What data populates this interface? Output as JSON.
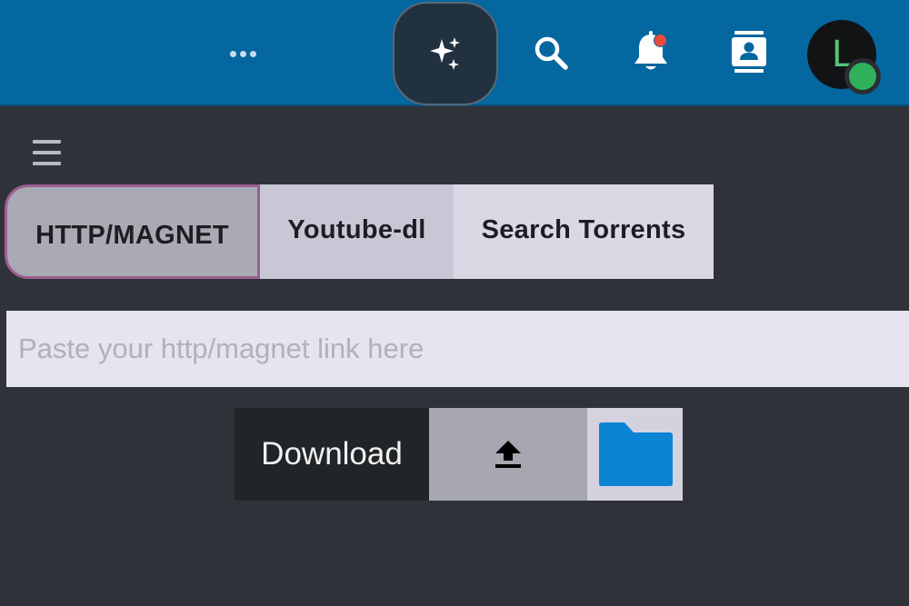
{
  "header": {
    "more_icon": "more-horizontal-icon",
    "ai_icon": "sparkles-icon",
    "search_icon": "search-icon",
    "bell_icon": "bell-icon",
    "bell_badge_color": "#e74c3c",
    "contacts_icon": "contacts-icon",
    "avatar_initial": "L",
    "presence_color": "#2fb05a",
    "bar_color": "#05679f"
  },
  "menu_icon": "hamburger-menu-icon",
  "tabs": [
    {
      "label": "HTTP/MAGNET",
      "active": true
    },
    {
      "label": "Youtube-dl",
      "active": false
    },
    {
      "label": "Search Torrents",
      "active": false
    }
  ],
  "link_input": {
    "placeholder": "Paste your http/magnet link here",
    "value": ""
  },
  "actions": {
    "download_label": "Download",
    "upload_icon": "upload-icon",
    "folder_icon": "folder-icon",
    "folder_color": "#0b84d6"
  }
}
